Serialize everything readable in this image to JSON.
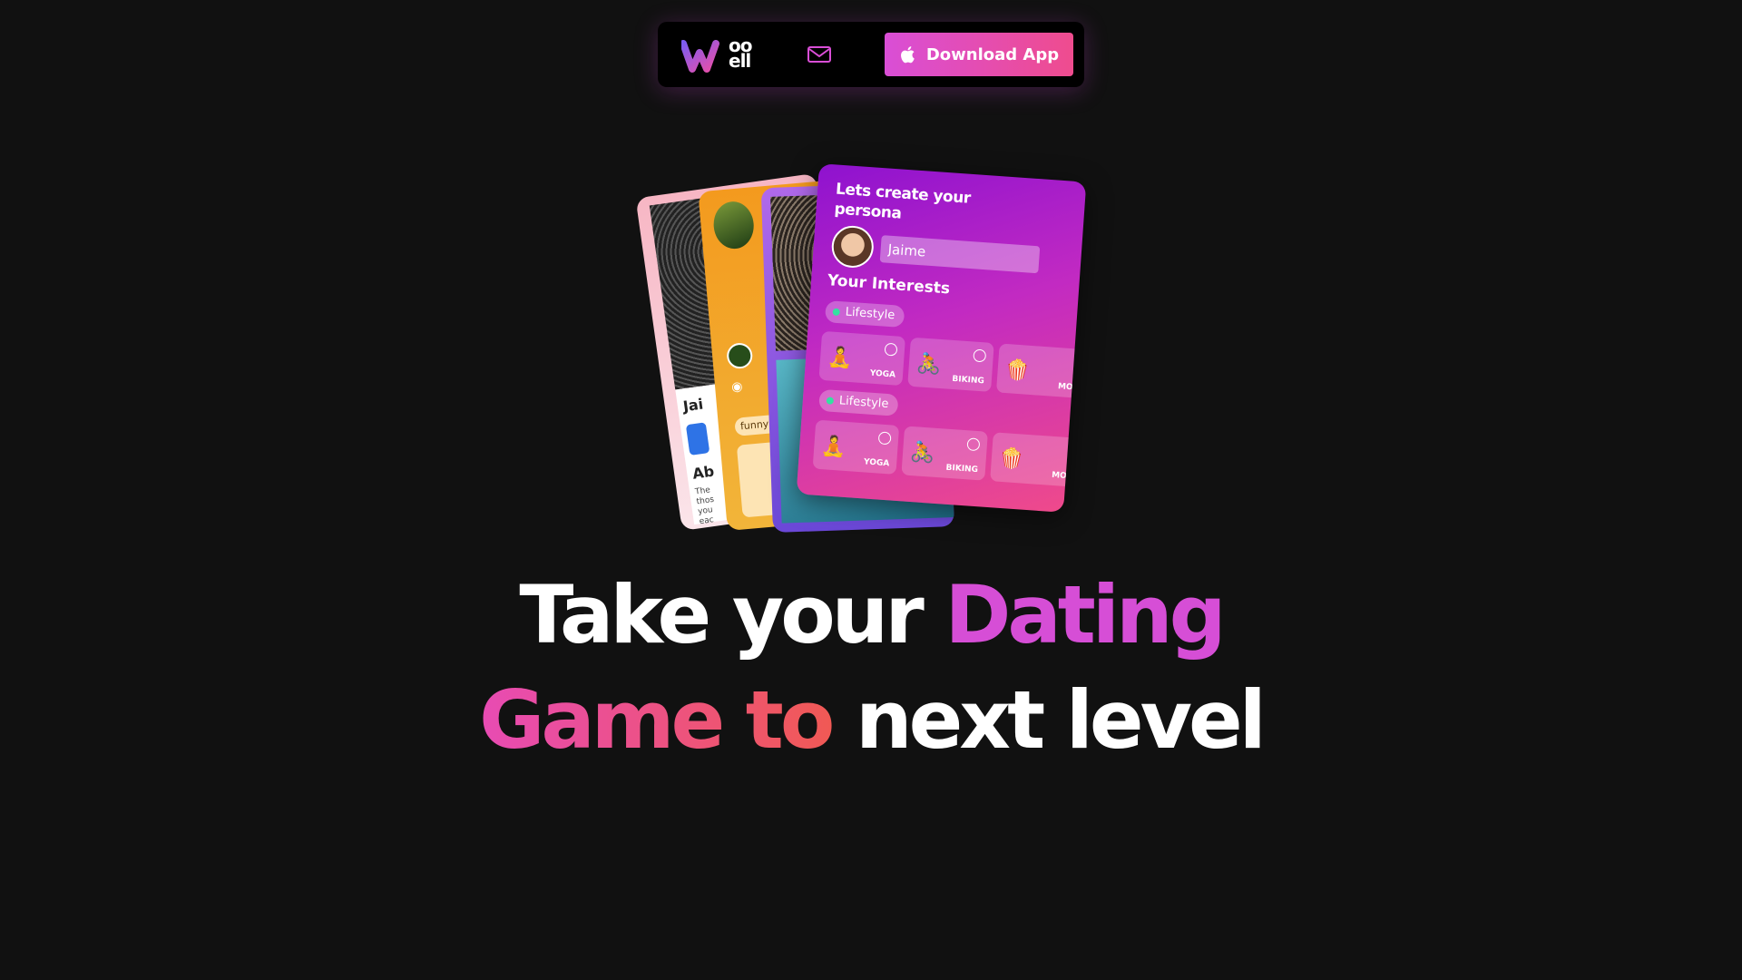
{
  "brand": {
    "logo_top": "oo",
    "logo_bottom": "ell",
    "accent_gradient": [
      "#d94ed6",
      "#ef4c8e"
    ]
  },
  "nav": {
    "mail_icon": "mail-icon",
    "download_label": "Download App",
    "download_icon": "apple-icon"
  },
  "cards": {
    "pink": {
      "name": "Jai",
      "about": "Ab",
      "bio": "The thos you eac con"
    },
    "orange": {
      "tag": "funny"
    },
    "main": {
      "title": "Lets create your persona",
      "name_value": "Jaime",
      "interests_heading": "Your Interests",
      "groups": [
        {
          "tag": "Lifestyle",
          "tiles": [
            {
              "emoji": "🧘",
              "label": "YOGA"
            },
            {
              "emoji": "🚴",
              "label": "BIKING"
            },
            {
              "emoji": "🍿",
              "label": "MO"
            }
          ]
        },
        {
          "tag": "Lifestyle",
          "tiles": [
            {
              "emoji": "🧘",
              "label": "YOGA"
            },
            {
              "emoji": "🚴",
              "label": "BIKING"
            },
            {
              "emoji": "🍿",
              "label": "MO"
            }
          ]
        }
      ]
    }
  },
  "headline": {
    "line1_plain": "Take your ",
    "line1_accent": "Dating",
    "line2_accent": "Game to ",
    "line2_plain": "next level",
    "colors": {
      "accent1": "#d64ed6",
      "accent2_from": "#e84bb4",
      "accent2_to": "#f15a4e"
    }
  }
}
